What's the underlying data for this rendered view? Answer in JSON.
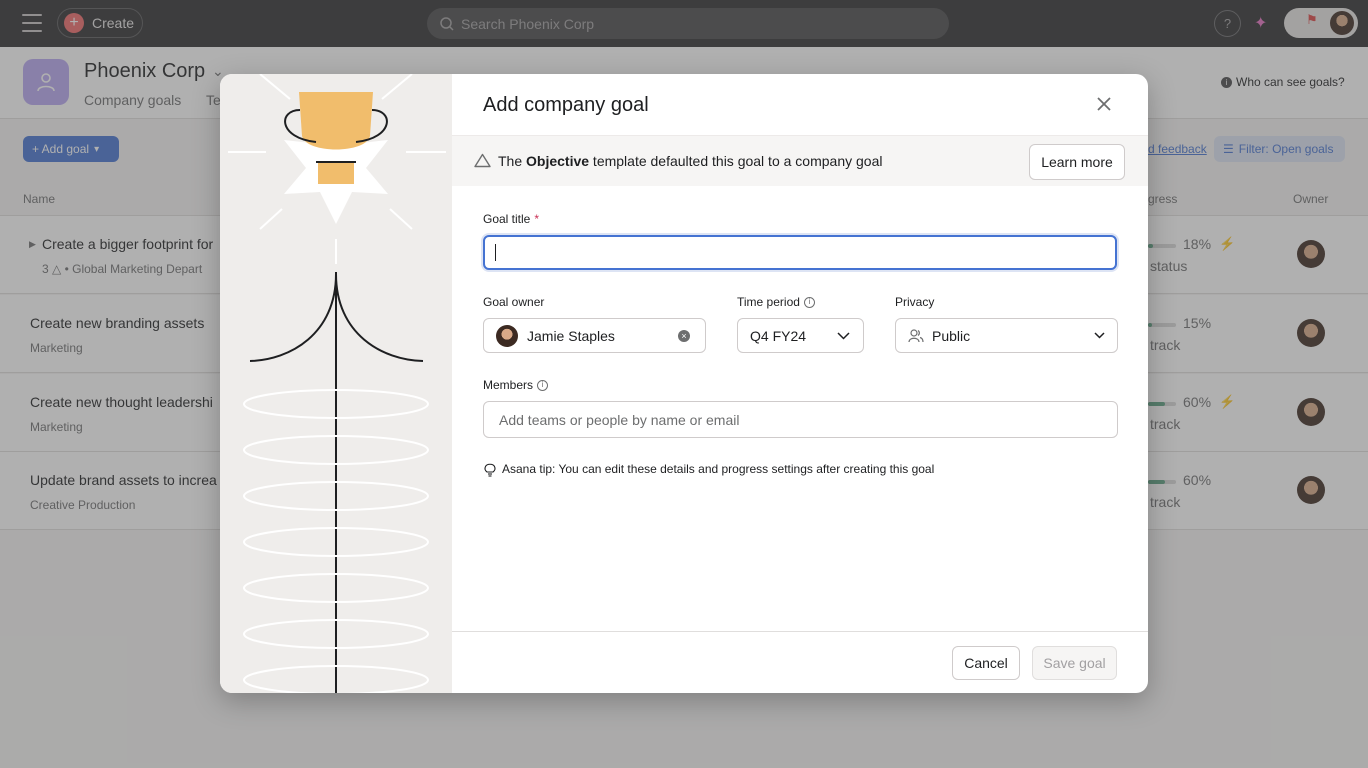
{
  "topbar": {
    "create_label": "Create",
    "search_placeholder": "Search Phoenix Corp",
    "help_label": "?"
  },
  "header": {
    "team_name": "Phoenix Corp",
    "tabs": [
      {
        "label": "Company goals"
      },
      {
        "label": "Te"
      }
    ],
    "who_can_see": "Who can see goals?"
  },
  "toolbar": {
    "add_goal_label": "+ Add goal",
    "feedback_link": "d feedback",
    "filter_label": "Filter: Open goals"
  },
  "table": {
    "columns": {
      "name": "Name",
      "progress": "gress",
      "owner": "Owner"
    },
    "rows": [
      {
        "title": "Create a bigger footprint for",
        "sub": "3 △ • Global Marketing Depart",
        "progress_pct": "18%",
        "progress_value": 18,
        "status": "status",
        "bolt": true
      },
      {
        "title": "Create new branding assets",
        "sub": "Marketing",
        "progress_pct": "15%",
        "progress_value": 15,
        "status": "track",
        "bolt": false
      },
      {
        "title": "Create new thought leadershi",
        "sub": "Marketing",
        "progress_pct": "60%",
        "progress_value": 60,
        "status": "track",
        "bolt": true
      },
      {
        "title": "Update brand assets to increa",
        "sub": "Creative Production",
        "progress_pct": "60%",
        "progress_value": 60,
        "status": "track",
        "bolt": false
      }
    ]
  },
  "modal": {
    "title": "Add company goal",
    "banner": {
      "prefix": "The ",
      "bold": "Objective",
      "suffix": " template defaulted this goal to a company goal",
      "learn_more": "Learn more"
    },
    "goal_title_label": "Goal title",
    "goal_title_required": "*",
    "goal_title_value": "",
    "goal_owner_label": "Goal owner",
    "goal_owner_value": "Jamie Staples",
    "time_period_label": "Time period",
    "time_period_value": "Q4 FY24",
    "privacy_label": "Privacy",
    "privacy_value": "Public",
    "members_label": "Members",
    "members_placeholder": "Add teams or people by name or email",
    "tip": "Asana tip: You can edit these details and progress settings after creating this goal",
    "cancel_label": "Cancel",
    "save_label": "Save goal"
  },
  "colors": {
    "accent": "#4573d2",
    "create_plus": "#f06a6a",
    "topbar_bg": "#2e2e30",
    "trophy": "#f1bd6c"
  }
}
